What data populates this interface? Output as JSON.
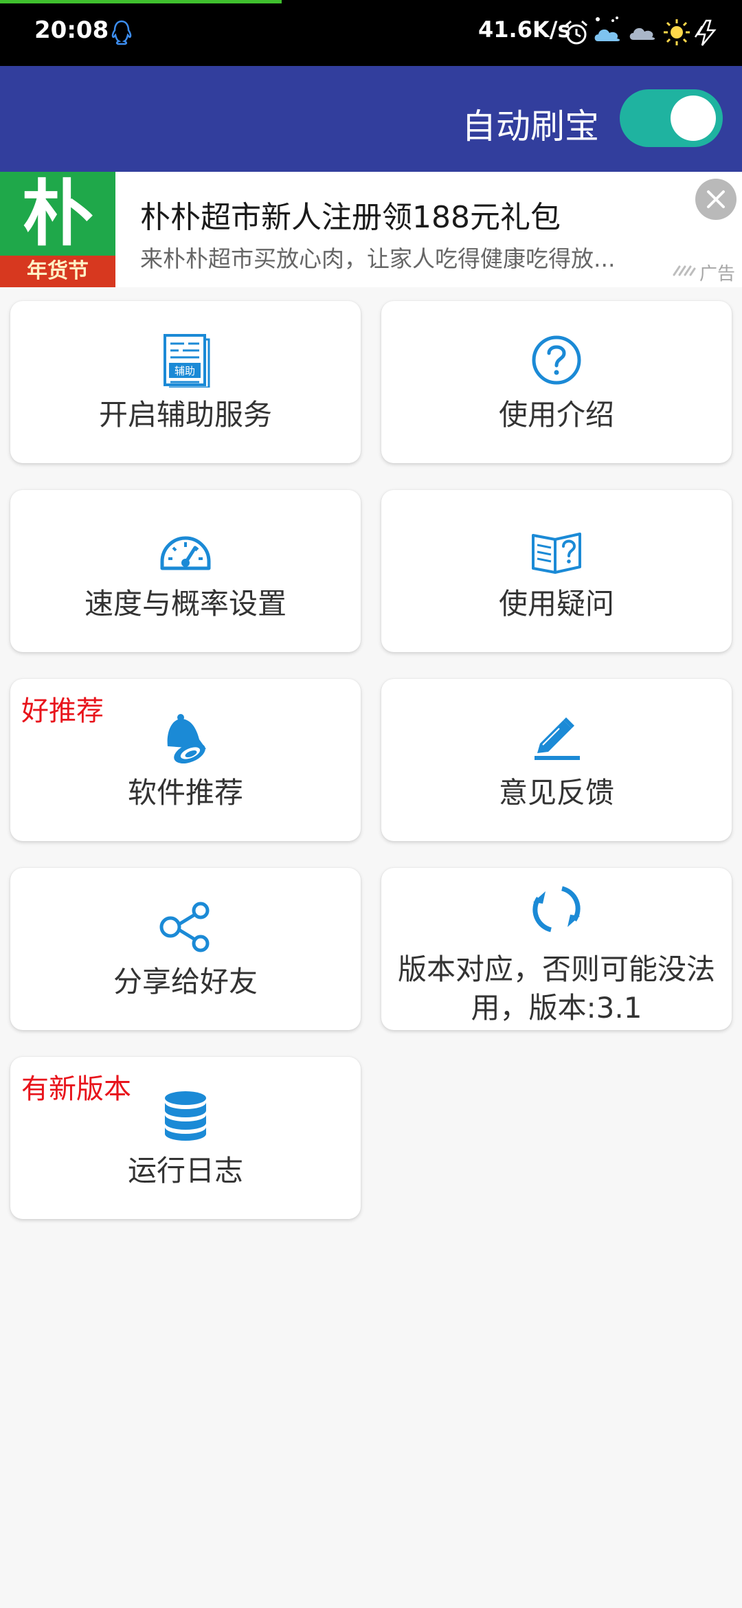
{
  "status_bar": {
    "time": "20:08",
    "net_speed": "41.6K/s",
    "load_progress": 0.38
  },
  "app_bar": {
    "toggle_label": "自动刷宝",
    "toggle_on": true
  },
  "ad": {
    "logo_char": "朴",
    "logo_strip_text": "年货节",
    "title": "朴朴超市新人注册领188元礼包",
    "description": "来朴朴超市买放心肉，让家人吃得健康吃得放...",
    "label": "广告"
  },
  "colors": {
    "app_bar": "#323e9d",
    "toggle_on": "#1fb3a0",
    "icon_blue": "#1b8ad6",
    "badge_red": "#e8141c",
    "ad_logo_green": "#1fa84a"
  },
  "cards": [
    {
      "label": "开启辅助服务",
      "icon": "assist-document-icon",
      "icon_text": "辅助"
    },
    {
      "label": "使用介绍",
      "icon": "help-circle-icon"
    },
    {
      "label": "速度与概率设置",
      "icon": "speedometer-icon"
    },
    {
      "label": "使用疑问",
      "icon": "book-question-icon"
    },
    {
      "label": "软件推荐",
      "icon": "bell-icon",
      "badge": "好推荐"
    },
    {
      "label": "意见反馈",
      "icon": "edit-pencil-icon"
    },
    {
      "label": "分享给好友",
      "icon": "share-icon"
    },
    {
      "label": "版本对应，否则可能没法用，版本:3.1",
      "icon": "refresh-icon"
    },
    {
      "label": "运行日志",
      "icon": "database-icon",
      "badge": "有新版本"
    }
  ]
}
